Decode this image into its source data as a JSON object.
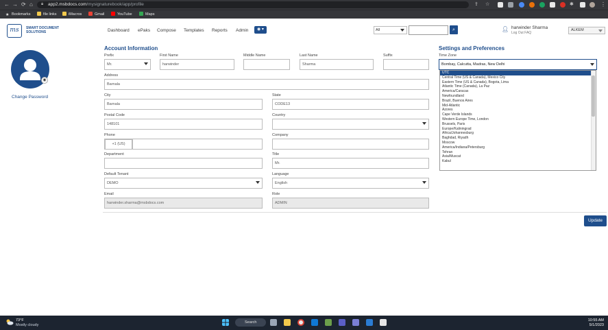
{
  "browser": {
    "url_host": "app2.msbdocs.com",
    "url_path": "/mysignaturebook/app/profile",
    "bookmarks": [
      "Bookmarks",
      "file links",
      "iMacros",
      "Gmail",
      "YouTube",
      "Maps"
    ]
  },
  "header": {
    "logo_glyph": "ms",
    "logo_text": "SMART DOCUMENT SOLUTIONS",
    "nav": [
      "Dashboard",
      "ePaks",
      "Compose",
      "Templates",
      "Reports",
      "Admin"
    ],
    "globe_label": "◉ ▾",
    "scope_value": "All",
    "user_name": "harwinder Sharma",
    "user_links": "Log Out   FAQ",
    "tenant_value": "ALKEM"
  },
  "profile": {
    "change_password": "Change Password"
  },
  "account": {
    "title": "Account Information",
    "prefix_label": "Prefix",
    "prefix_value": "Mr.",
    "first_name_label": "First Name",
    "first_name_value": "harwinder",
    "middle_name_label": "Middle Name",
    "middle_name_value": "",
    "last_name_label": "Last Name",
    "last_name_value": "Sharma",
    "suffix_label": "Suffix",
    "suffix_value": "",
    "address_label": "Address",
    "address_value": "Barnala",
    "city_label": "City",
    "city_value": "Barnala",
    "state_label": "State",
    "state_value": "CODE13",
    "postal_label": "Postal Code",
    "postal_value": "148101",
    "country_label": "Country",
    "country_value": "",
    "phone_label": "Phone",
    "phone_code": "+1 (US)",
    "phone_value": "",
    "company_label": "Company",
    "company_value": "",
    "department_label": "Department",
    "department_value": "",
    "title_label": "Title",
    "title_value": "Mr.",
    "tenant_label": "Default Tenant",
    "tenant_value": "DEMO",
    "language_label": "Language",
    "language_value": "English",
    "email_label": "Email",
    "email_value": "harwinder.sharma@msbdocs.com",
    "role_label": "Role",
    "role_value": "ADMIN"
  },
  "settings": {
    "title": "Settings and Preferences",
    "timezone_label": "Time Zone",
    "timezone_value": "Bombay, Calcutta, Madras, New Delhi",
    "timezone_options": [
      "UTC",
      "Central Time (US & Canada), Mexico City",
      "Eastern Time (US & Canada), Bogota, Lima",
      "Atlantic Time (Canada), La Paz",
      "America/Caracas",
      "Newfoundland",
      "Brazil, Buenos Aires",
      "Mid-Atlantic",
      "Azores",
      "Cape Verde Islands",
      "Western Europe Time, London",
      "Brussels, Paris",
      "Europe/Kaliningrad",
      "Africa/Johannesburg",
      "Baghdad, Riyadh",
      "Moscow",
      "America/Indiana/Petersburg",
      "Tehran",
      "Asia/Muscat",
      "Kabul"
    ],
    "selected_option_index": 0
  },
  "actions": {
    "update": "Update"
  },
  "taskbar": {
    "temperature": "73°F",
    "weather": "Mostly cloudy",
    "search": "Search",
    "time": "10:55 AM",
    "date": "5/1/2023"
  },
  "colors": {
    "brand": "#1f4e8c",
    "chrome": "#35363a",
    "taskbar": "#1c2430"
  }
}
